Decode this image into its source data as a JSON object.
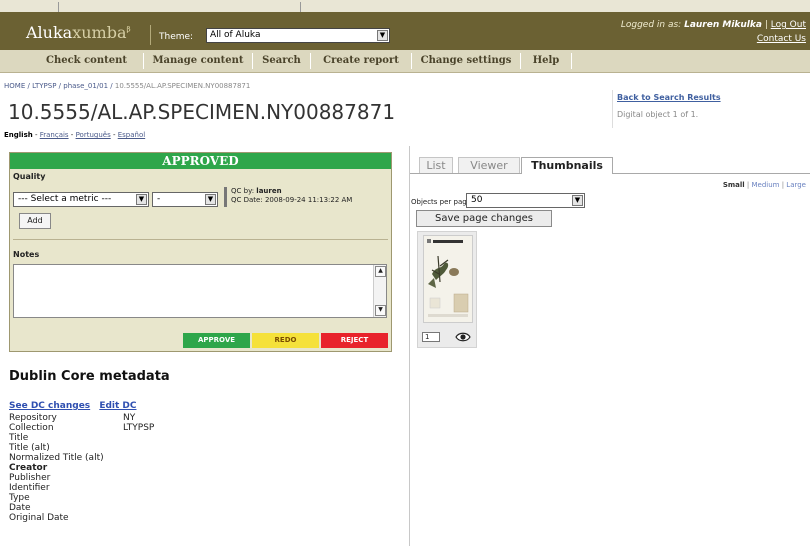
{
  "header": {
    "logo_main": "Aluka",
    "logo_accent": "xumba",
    "logo_mark": "β",
    "theme_label": "Theme:",
    "theme_value": "All of Aluka",
    "logged_prefix": "Logged in as:",
    "user": "Lauren Mikulka",
    "logout": "Log Out",
    "contact": "Contact Us"
  },
  "nav": [
    "Check content",
    "Manage content",
    "Search",
    "Create report",
    "Change settings",
    "Help"
  ],
  "breadcrumb": {
    "items": [
      "HOME",
      "LTYPSP",
      "phase_01/01"
    ],
    "current": "10.5555/AL.AP.SPECIMEN.NY00887871"
  },
  "page_title": "10.5555/AL.AP.SPECIMEN.NY00887871",
  "languages": {
    "current": "English",
    "others": [
      "Français",
      "Português",
      "Español"
    ]
  },
  "right_info": {
    "back_link": "Back to Search Results",
    "digital_object": "Digital object 1 of 1."
  },
  "qc": {
    "status": "APPROVED",
    "quality_label": "Quality",
    "metric_placeholder": "--- Select a metric ---",
    "dash_value": "-",
    "qc_by_label": "QC by:",
    "qc_by": "lauren",
    "qc_date_label": "QC Date:",
    "qc_date": "2008-09-24 11:13:22 AM",
    "add_label": "Add",
    "notes_label": "Notes",
    "notes_value": "",
    "approve": "APPROVE",
    "redo": "REDO",
    "reject": "REJECT",
    "colors": {
      "approve": "#2ea64a",
      "redo": "#f5e13a",
      "reject": "#e8232b"
    }
  },
  "dublin_core": {
    "title": "Dublin Core metadata",
    "see_changes": "See DC changes",
    "edit": "Edit DC",
    "fields": [
      {
        "label": "Repository",
        "value": "NY",
        "bold": false
      },
      {
        "label": "Collection",
        "value": "LTYPSP",
        "bold": false
      },
      {
        "label": "Title",
        "value": "",
        "bold": false
      },
      {
        "label": "Title (alt)",
        "value": "",
        "bold": false
      },
      {
        "label": "Normalized Title (alt)",
        "value": "",
        "bold": false
      },
      {
        "label": "Creator",
        "value": "",
        "bold": true
      },
      {
        "label": "Publisher",
        "value": "",
        "bold": false
      },
      {
        "label": "Identifier",
        "value": "",
        "bold": false
      },
      {
        "label": "Type",
        "value": "",
        "bold": false
      },
      {
        "label": "Date",
        "value": "",
        "bold": false
      },
      {
        "label": "Original Date",
        "value": "",
        "bold": false
      }
    ]
  },
  "viewer": {
    "tabs": [
      "List",
      "Viewer",
      "Thumbnails"
    ],
    "active_tab": "Thumbnails",
    "sizes": {
      "current": "Small",
      "others": [
        "Medium",
        "Large"
      ]
    },
    "objects_per_page_label": "Objects per page:",
    "objects_per_page": "50",
    "save_label": "Save page changes",
    "thumbnail": {
      "page_number": "1",
      "icon": "eye-icon"
    }
  }
}
